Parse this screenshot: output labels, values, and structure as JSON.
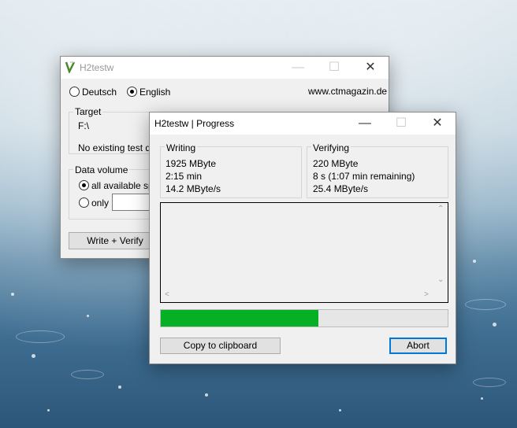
{
  "main_window": {
    "title": "H2testw",
    "lang_deutsch": "Deutsch",
    "lang_english": "English",
    "lang_selected": "English",
    "website": "www.ctmagazin.de",
    "target_label": "Target",
    "target_path": "F:\\",
    "target_status": "No existing test data",
    "data_volume_label": "Data volume",
    "all_space_label": "all available space",
    "only_label": "only",
    "only_value": "",
    "write_verify_label": "Write + Verify"
  },
  "progress_window": {
    "title": "H2testw | Progress",
    "writing": {
      "label": "Writing",
      "amount": "1925 MByte",
      "time": "2:15 min",
      "speed": "14.2 MByte/s"
    },
    "verifying": {
      "label": "Verifying",
      "amount": "220 MByte",
      "time": "8 s (1:07 min remaining)",
      "speed": "25.4 MByte/s"
    },
    "progress_fraction": 0.55,
    "progress_color": "#06b025",
    "copy_label": "Copy to clipboard",
    "abort_label": "Abort"
  },
  "icons": {
    "minimize": "—",
    "maximize": "☐",
    "close": "✕"
  }
}
